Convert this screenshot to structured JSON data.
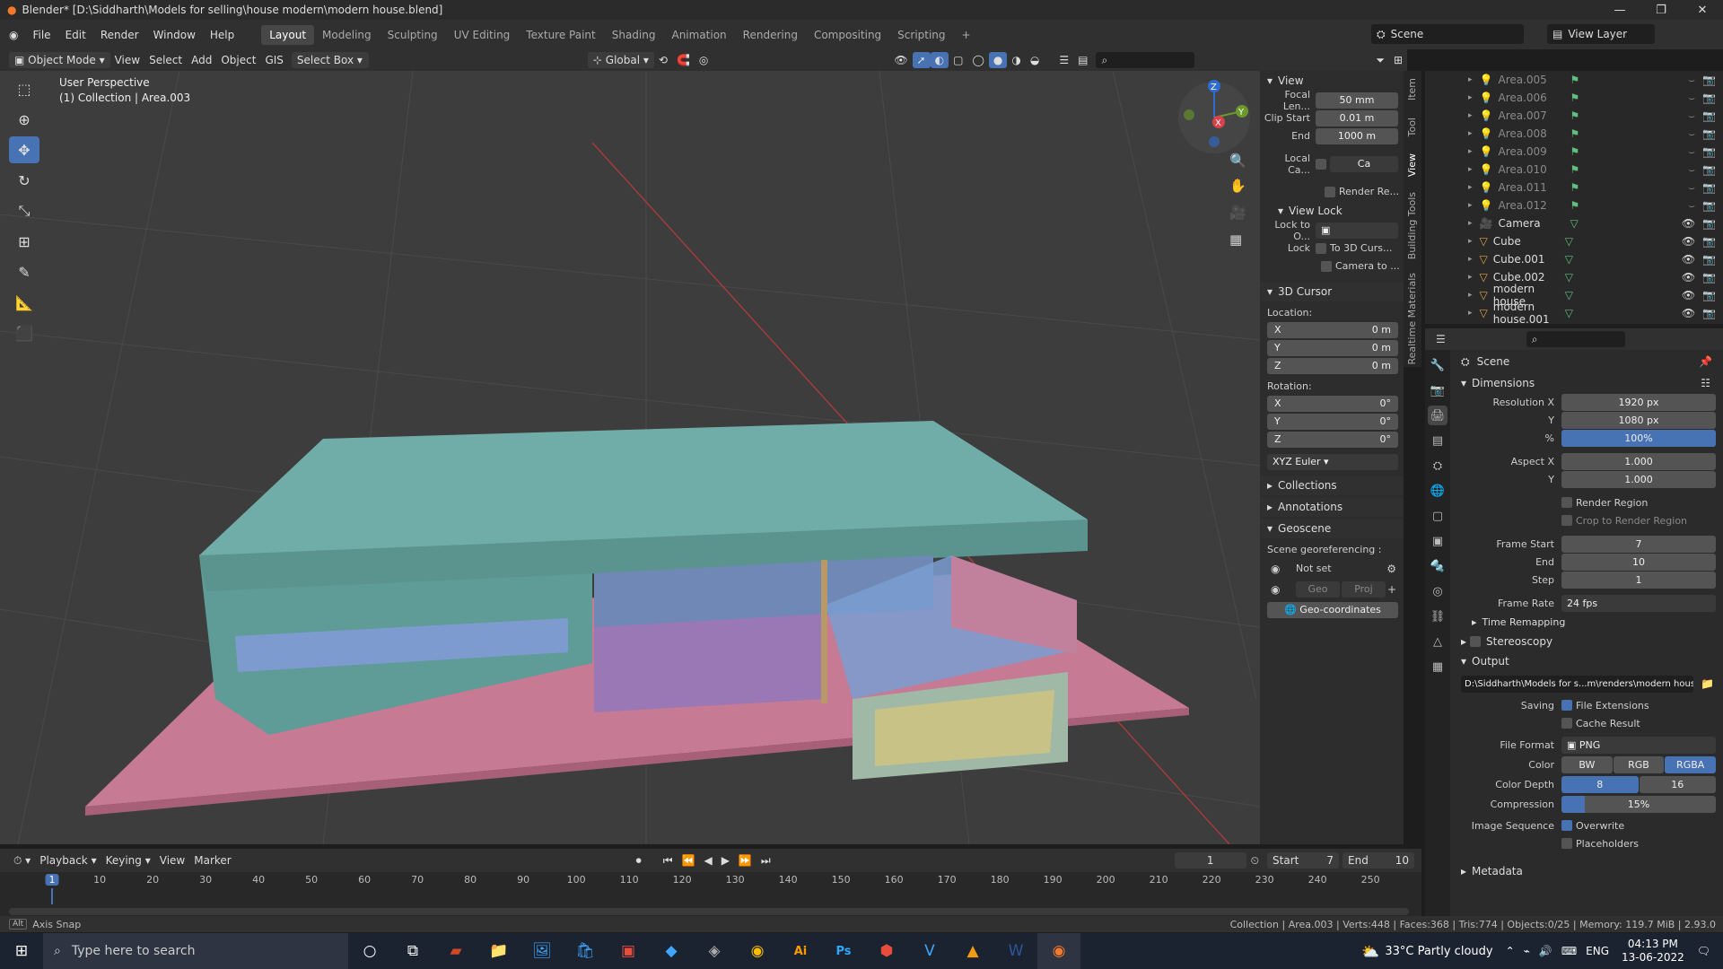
{
  "title": "Blender* [D:\\Siddharth\\Models for selling\\house modern\\modern house.blend]",
  "menu": [
    "File",
    "Edit",
    "Render",
    "Window",
    "Help"
  ],
  "workspaces": [
    "Layout",
    "Modeling",
    "Sculpting",
    "UV Editing",
    "Texture Paint",
    "Shading",
    "Animation",
    "Rendering",
    "Compositing",
    "Scripting",
    "+"
  ],
  "scene": "Scene",
  "view_layer": "View Layer",
  "header": {
    "mode": "Object Mode",
    "view": "View",
    "select": "Select",
    "add": "Add",
    "object": "Object",
    "gis": "GIS",
    "select_box": "Select Box",
    "orientation": "Global"
  },
  "viewport": {
    "perspective": "User Perspective",
    "collection": "(1) Collection | Area.003"
  },
  "npanel": {
    "view_title": "View",
    "focal_label": "Focal Len...",
    "focal": "50 mm",
    "clip_start_label": "Clip Start",
    "clip_start": "0.01 m",
    "end_label": "End",
    "end": "1000 m",
    "local_cam_label": "Local Ca...",
    "local_cam_field": "Ca",
    "render_region": "Render Re...",
    "view_lock": "View Lock",
    "lock_to_label": "Lock to O...",
    "lock_label": "Lock",
    "to_cursor": "To 3D Curs...",
    "camera_to": "Camera to ...",
    "cursor_title": "3D Cursor",
    "location": "Location:",
    "rotation": "Rotation:",
    "x": "X",
    "y": "Y",
    "z": "Z",
    "loc_x": "0 m",
    "loc_y": "0 m",
    "loc_z": "0 m",
    "rot_x": "0°",
    "rot_y": "0°",
    "rot_z": "0°",
    "rot_mode": "XYZ Euler",
    "collections": "Collections",
    "annotations": "Annotations",
    "geoscene": "Geoscene",
    "georef": "Scene georeferencing :",
    "not_set": "Not set",
    "geo": "Geo",
    "proj": "Proj",
    "geocoords": "Geo-coordinates"
  },
  "ntabs": [
    "Item",
    "Tool",
    "View",
    "Building Tools",
    "Realtime Materials"
  ],
  "outliner": [
    "Area.005",
    "Area.006",
    "Area.007",
    "Area.008",
    "Area.009",
    "Area.010",
    "Area.011",
    "Area.012",
    "Camera",
    "Cube",
    "Cube.001",
    "Cube.002",
    "modern house",
    "modern house.001"
  ],
  "props": {
    "scene": "Scene",
    "dimensions": "Dimensions",
    "res_x_label": "Resolution X",
    "res_x": "1920 px",
    "y_label": "Y",
    "res_y": "1080 px",
    "pct_label": "%",
    "pct": "100%",
    "aspect_x_label": "Aspect X",
    "aspect_x": "1.000",
    "aspect_y": "1.000",
    "render_region": "Render Region",
    "crop": "Crop to Render Region",
    "frame_start_label": "Frame Start",
    "frame_start": "7",
    "end_label": "End",
    "frame_end": "10",
    "step_label": "Step",
    "step": "1",
    "frame_rate_label": "Frame Rate",
    "frame_rate": "24 fps",
    "time_remap": "Time Remapping",
    "stereoscopy": "Stereoscopy",
    "output": "Output",
    "path": "D:\\Siddharth\\Models for s...m\\renders\\modern house",
    "saving_label": "Saving",
    "file_ext": "File Extensions",
    "cache": "Cache Result",
    "file_format_label": "File Format",
    "file_format": "PNG",
    "color_label": "Color",
    "bw": "BW",
    "rgb": "RGB",
    "rgba": "RGBA",
    "depth_label": "Color Depth",
    "d8": "8",
    "d16": "16",
    "comp_label": "Compression",
    "comp": "15%",
    "imgseq_label": "Image Sequence",
    "overwrite": "Overwrite",
    "placeholders": "Placeholders",
    "metadata": "Metadata"
  },
  "timeline": {
    "playback": "Playback",
    "keying": "Keying",
    "view": "View",
    "marker": "Marker",
    "frame": "1",
    "start_label": "Start",
    "start": "7",
    "end_label": "End",
    "end": "10",
    "ticks": [
      "1",
      "10",
      "20",
      "30",
      "40",
      "50",
      "60",
      "70",
      "80",
      "90",
      "100",
      "110",
      "120",
      "130",
      "140",
      "150",
      "160",
      "170",
      "180",
      "190",
      "200",
      "210",
      "220",
      "230",
      "240",
      "250"
    ]
  },
  "status": {
    "left": "Axis Snap",
    "right": "Collection | Area.003 | Verts:448 | Faces:368 | Tris:774 | Objects:0/25 | Memory: 119.7 MiB | 2.93.0"
  },
  "taskbar": {
    "search": "Type here to search",
    "weather": "33°C  Partly cloudy",
    "lang": "ENG",
    "time": "04:13 PM",
    "date": "13-06-2022"
  }
}
